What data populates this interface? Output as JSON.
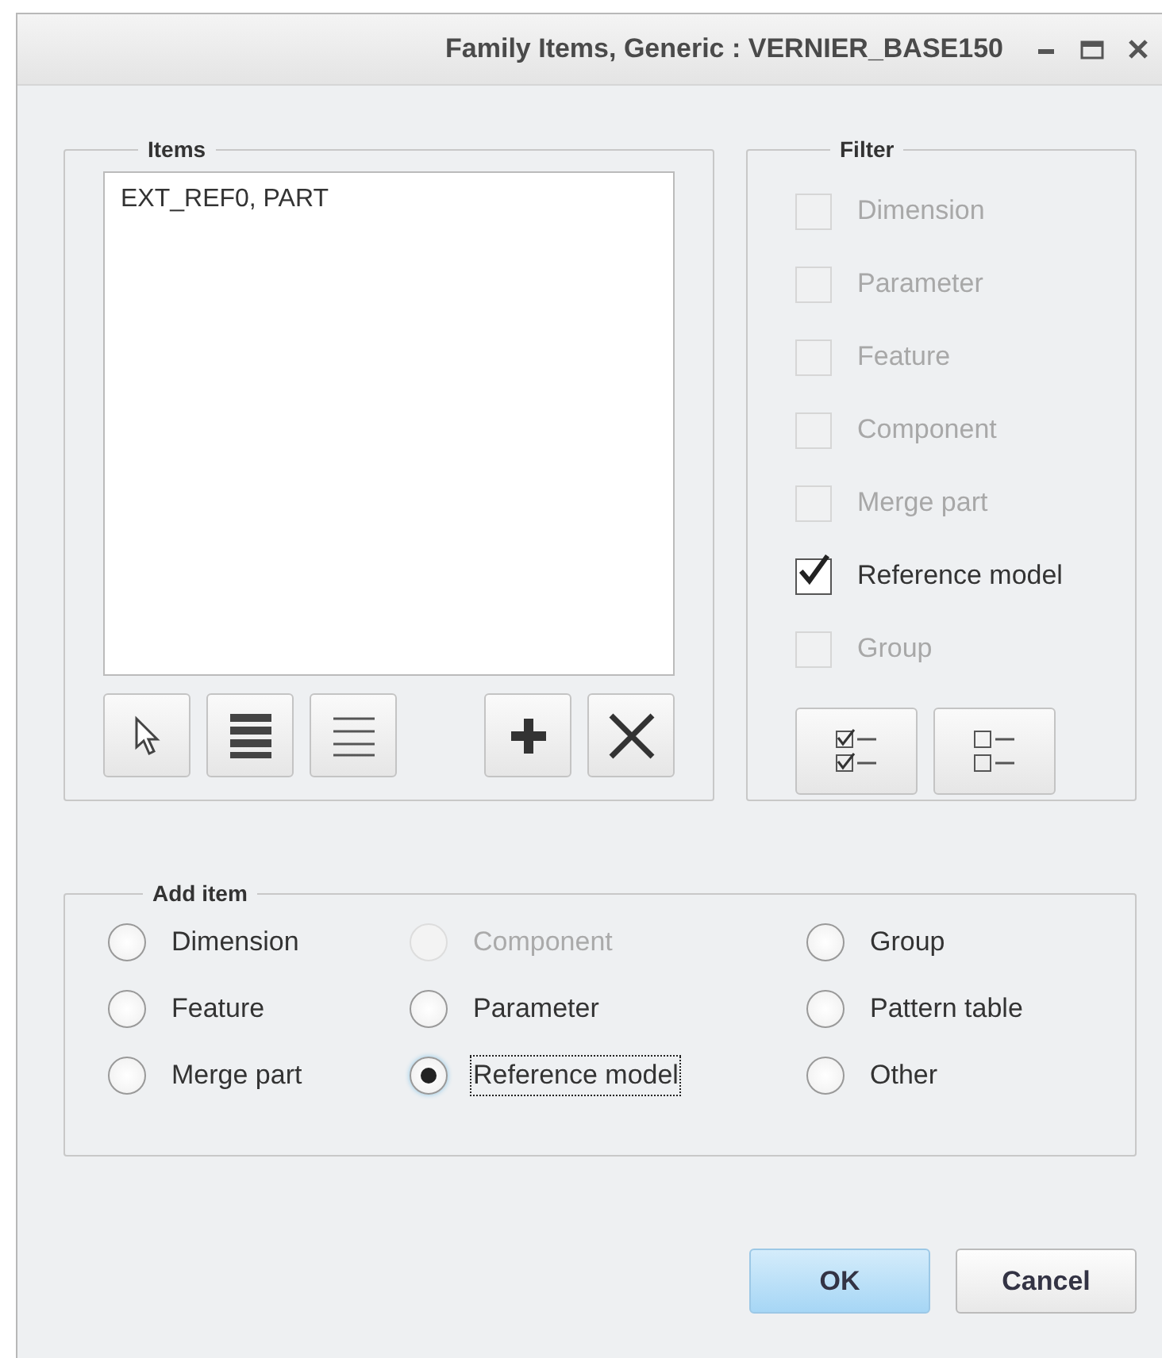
{
  "window": {
    "title": "Family Items,  Generic : VERNIER_BASE150"
  },
  "items": {
    "label": "Items",
    "list": [
      "EXT_REF0, PART"
    ]
  },
  "filter": {
    "label": "Filter",
    "options": [
      {
        "label": "Dimension",
        "checked": false,
        "disabled": true
      },
      {
        "label": "Parameter",
        "checked": false,
        "disabled": true
      },
      {
        "label": "Feature",
        "checked": false,
        "disabled": true
      },
      {
        "label": "Component",
        "checked": false,
        "disabled": true
      },
      {
        "label": "Merge part",
        "checked": false,
        "disabled": true
      },
      {
        "label": "Reference model",
        "checked": true,
        "disabled": false
      },
      {
        "label": "Group",
        "checked": false,
        "disabled": true
      }
    ]
  },
  "add_item": {
    "label": "Add item",
    "options": [
      {
        "label": "Dimension",
        "selected": false,
        "disabled": false
      },
      {
        "label": "Component",
        "selected": false,
        "disabled": true
      },
      {
        "label": "Group",
        "selected": false,
        "disabled": false
      },
      {
        "label": "Feature",
        "selected": false,
        "disabled": false
      },
      {
        "label": "Parameter",
        "selected": false,
        "disabled": false
      },
      {
        "label": "Pattern table",
        "selected": false,
        "disabled": false
      },
      {
        "label": "Merge part",
        "selected": false,
        "disabled": false
      },
      {
        "label": "Reference model",
        "selected": true,
        "disabled": false
      },
      {
        "label": "Other",
        "selected": false,
        "disabled": false
      }
    ]
  },
  "buttons": [
    {
      "label": "OK",
      "kind": "primary"
    },
    {
      "label": "Cancel",
      "kind": "normal"
    }
  ]
}
